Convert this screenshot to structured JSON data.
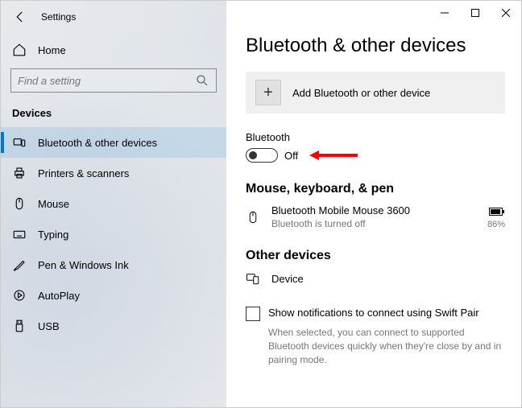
{
  "appTitle": "Settings",
  "home": "Home",
  "search": {
    "placeholder": "Find a setting"
  },
  "sectionHeader": "Devices",
  "nav": [
    {
      "label": "Bluetooth & other devices"
    },
    {
      "label": "Printers & scanners"
    },
    {
      "label": "Mouse"
    },
    {
      "label": "Typing"
    },
    {
      "label": "Pen & Windows Ink"
    },
    {
      "label": "AutoPlay"
    },
    {
      "label": "USB"
    }
  ],
  "pageTitle": "Bluetooth & other devices",
  "addDevice": "Add Bluetooth or other device",
  "bluetooth": {
    "label": "Bluetooth",
    "state": "Off"
  },
  "mouseSection": {
    "title": "Mouse, keyboard, & pen",
    "deviceName": "Bluetooth Mobile Mouse 3600",
    "status": "Bluetooth is turned off",
    "battery": "86%"
  },
  "otherSection": {
    "title": "Other devices",
    "deviceName": "Device"
  },
  "swiftPair": {
    "label": "Show notifications to connect using Swift Pair",
    "hint": "When selected, you can connect to supported Bluetooth devices quickly when they're close by and in pairing mode."
  }
}
